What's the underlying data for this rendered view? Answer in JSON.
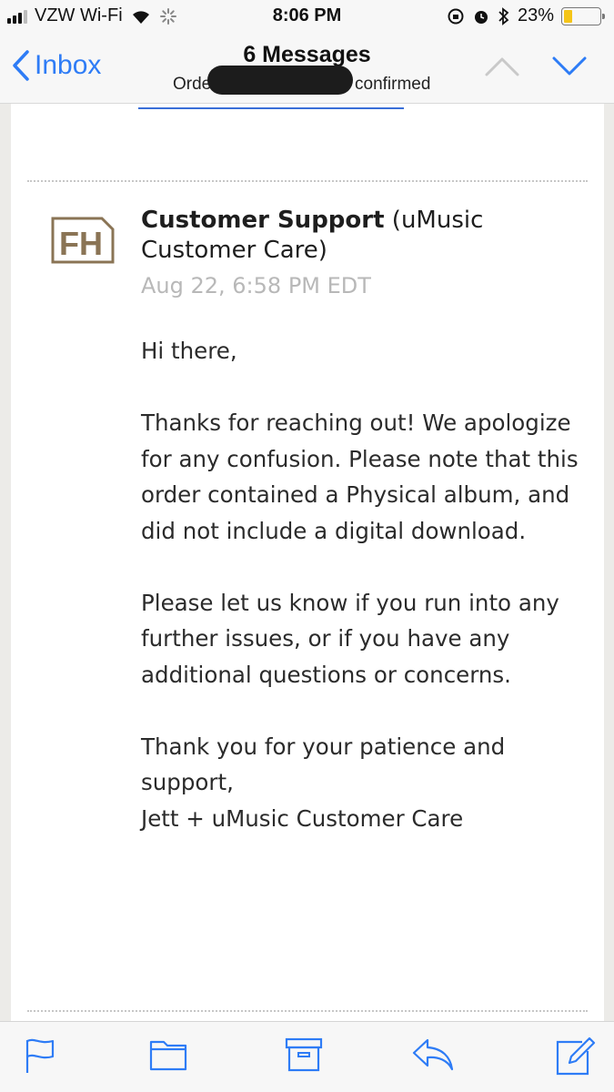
{
  "status_bar": {
    "carrier": "VZW Wi-Fi",
    "time": "8:06 PM",
    "battery_percent": "23%",
    "battery_level": 0.23,
    "battery_color": "#f5c518"
  },
  "nav": {
    "back_label": "Inbox",
    "title": "6 Messages",
    "subtitle_left": "Orde",
    "subtitle_right": "confirmed",
    "accent_color": "#2e7cf6",
    "icons": [
      "chevron-left-icon",
      "chevron-up-icon",
      "chevron-down-icon"
    ]
  },
  "message": {
    "logo_text": "FH",
    "logo_color": "#8a7455",
    "sender_name": "Customer Support",
    "sender_org": "(uMusic Customer Care)",
    "date": "Aug 22, 6:58 PM EDT",
    "greeting": "Hi there,",
    "paragraph1": "Thanks for reaching out! We apologize for any confusion. Please note that this order contained a Physical album, and did not include a digital download.",
    "paragraph2": "Please let us know if you run into any further issues, or if you have any additional questions or concerns.",
    "closing_line1": "Thank you for your patience and support,",
    "closing_line2": "Jett + uMusic Customer Care"
  },
  "toolbar": {
    "icons": [
      "flag-icon",
      "folder-icon",
      "archive-icon",
      "reply-icon",
      "compose-icon"
    ]
  }
}
